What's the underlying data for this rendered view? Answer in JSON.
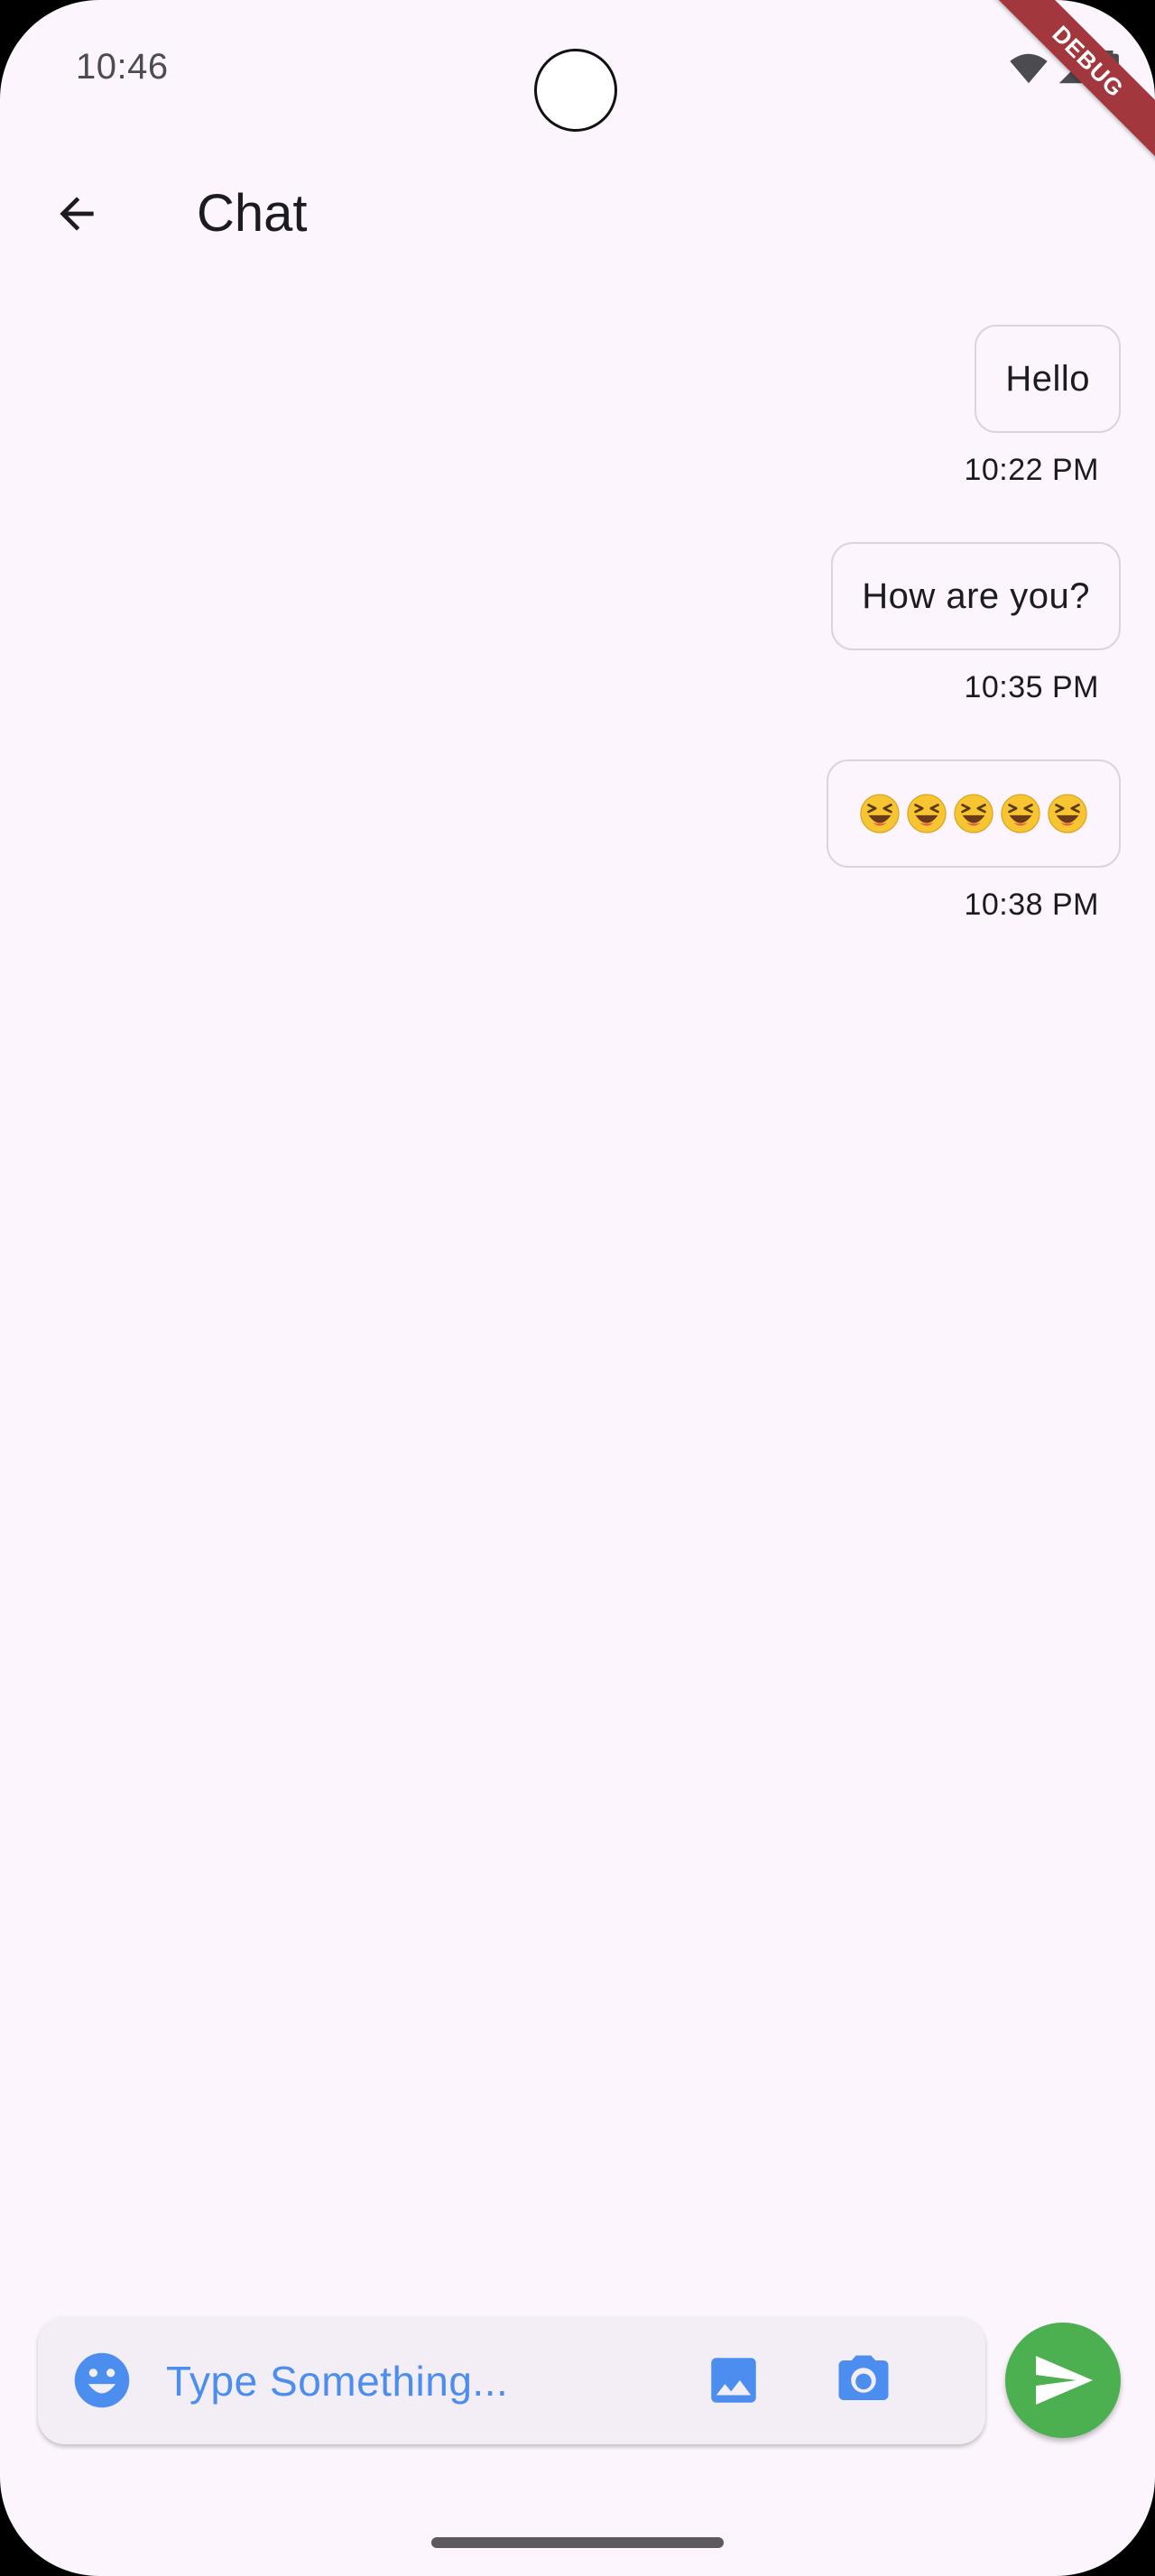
{
  "status_bar": {
    "time": "10:46",
    "icons": [
      "wifi-icon",
      "signal-icon",
      "battery-icon"
    ]
  },
  "debug_banner": {
    "label": "DEBUG",
    "color": "#a2383d"
  },
  "app_bar": {
    "back_icon": "arrow-back-icon",
    "title": "Chat"
  },
  "messages": [
    {
      "text": "Hello",
      "time": "10:22 PM",
      "sender": "me"
    },
    {
      "text": "How are you?",
      "time": "10:35 PM",
      "sender": "me"
    },
    {
      "text": "😆😆😆😆😆",
      "time": "10:38 PM",
      "sender": "me",
      "emoji_count": 5,
      "emoji_icon": "laughing-face-icon"
    }
  ],
  "input_bar": {
    "placeholder": "Type Something...",
    "value": "",
    "emoji_icon": "emoji-icon",
    "image_icon": "image-icon",
    "camera_icon": "camera-icon",
    "accent_color": "#4c8ef0"
  },
  "send_button": {
    "icon": "send-icon",
    "color": "#4caf50"
  },
  "colors": {
    "background": "#fcf5fd",
    "bubble_border": "#dad4dd",
    "input_background": "#f3edf5"
  }
}
